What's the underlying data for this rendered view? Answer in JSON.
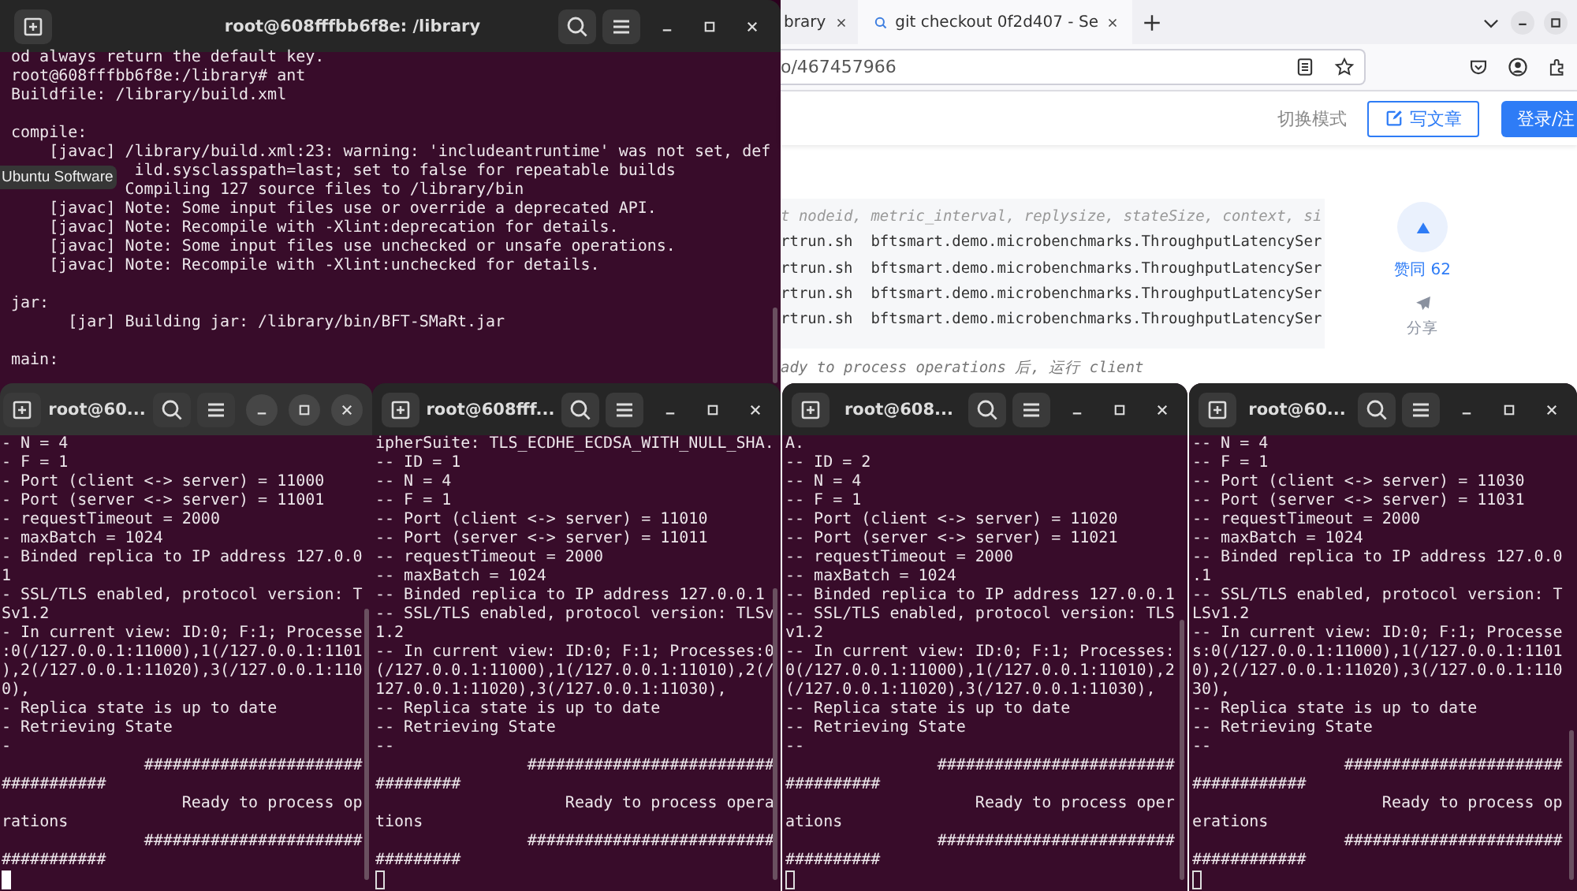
{
  "tooltip": "Ubuntu Software",
  "browser": {
    "tabs": [
      {
        "label": "brary",
        "selected": false
      },
      {
        "label": "git checkout 0f2d407 - Se",
        "selected": true
      }
    ],
    "url": "o/467457966",
    "header": {
      "mode_link": "切换模式",
      "write_button": "写文章",
      "login_button": "登录/注"
    },
    "code_lines": [
      {
        "kind": "comment",
        "text": "t nodeid, metric_interval, replysize, stateSize, context, si"
      },
      {
        "kind": "code",
        "text": "rtrun.sh  bftsmart.demo.microbenchmarks.ThroughputLatencySer"
      },
      {
        "kind": "code",
        "text": "rtrun.sh  bftsmart.demo.microbenchmarks.ThroughputLatencySer"
      },
      {
        "kind": "code",
        "text": "rtrun.sh  bftsmart.demo.microbenchmarks.ThroughputLatencySer"
      },
      {
        "kind": "code",
        "text": "rtrun.sh  bftsmart.demo.microbenchmarks.ThroughputLatencySer"
      }
    ],
    "after_code": "ady to process operations 后, 运行 client",
    "like_label": "赞同 62",
    "share_label": "分享"
  },
  "terminals": [
    {
      "title": "root@608fffbb6f8e: /library",
      "active": false,
      "blocks": [
        [
          "od always return the default key.",
          "root@608fffbb6f8e:/library# ant",
          "Buildfile: /library/build.xml"
        ],
        [
          "compile:",
          "    [javac] /library/build.xml:23: warning: 'includeantruntime' was not set, def",
          "             ild.sysclasspath=last; set to false for repeatable builds",
          "            Compiling 127 source files to /library/bin",
          "    [javac] Note: Some input files use or override a deprecated API.",
          "    [javac] Note: Recompile with -Xlint:deprecation for details.",
          "    [javac] Note: Some input files use unchecked or unsafe operations.",
          "    [javac] Note: Recompile with -Xlint:unchecked for details."
        ],
        [
          "jar:",
          "      [jar] Building jar: /library/bin/BFT-SMaRt.jar"
        ],
        [
          "main:"
        ]
      ]
    },
    {
      "title": "root@60...",
      "active": true,
      "cursor": true,
      "blocks": [
        [
          "- N = 4",
          "- F = 1",
          "- Port (client <-> server) = 11000",
          "- Port (server <-> server) = 11001",
          "- requestTimeout = 2000",
          "- maxBatch = 1024",
          "- Binded replica to IP address 127.0.0",
          "1",
          "- SSL/TLS enabled, protocol version: T",
          "Sv1.2",
          "- In current view: ID:0; F:1; Processe",
          ":0(/127.0.0.1:11000),1(/127.0.0.1:1101",
          "),2(/127.0.0.1:11020),3(/127.0.0.1:110",
          "0),",
          "- Replica state is up to date",
          "- Retrieving State",
          "-",
          "               #######################",
          "###########",
          "                   Ready to process op",
          "rations",
          "               #######################",
          "###########"
        ]
      ]
    },
    {
      "title": "root@608fff...",
      "active": false,
      "cursor": true,
      "blocks": [
        [
          "ipherSuite: TLS_ECDHE_ECDSA_WITH_NULL_SHA.",
          "-- ID = 1",
          "-- N = 4",
          "-- F = 1",
          "-- Port (client <-> server) = 11010",
          "-- Port (server <-> server) = 11011",
          "-- requestTimeout = 2000",
          "-- maxBatch = 1024",
          "-- Binded replica to IP address 127.0.0.1",
          "-- SSL/TLS enabled, protocol version: TLSv",
          "1.2",
          "-- In current view: ID:0; F:1; Processes:0",
          "(/127.0.0.1:11000),1(/127.0.0.1:11010),2(/",
          "127.0.0.1:11020),3(/127.0.0.1:11030),",
          "-- Replica state is up to date",
          "-- Retrieving State",
          "--",
          "                ##########################",
          "#########",
          "                    Ready to process opera",
          "tions",
          "                ##########################",
          "#########"
        ]
      ]
    },
    {
      "title": "root@608...",
      "active": false,
      "cursor": true,
      "blocks": [
        [
          "A.",
          "-- ID = 2",
          "-- N = 4",
          "-- F = 1",
          "-- Port (client <-> server) = 11020",
          "-- Port (server <-> server) = 11021",
          "-- requestTimeout = 2000",
          "-- maxBatch = 1024",
          "-- Binded replica to IP address 127.0.0.1",
          "-- SSL/TLS enabled, protocol version: TLS",
          "v1.2",
          "-- In current view: ID:0; F:1; Processes:",
          "0(/127.0.0.1:11000),1(/127.0.0.1:11010),2",
          "(/127.0.0.1:11020),3(/127.0.0.1:11030),",
          "-- Replica state is up to date",
          "-- Retrieving State",
          "--",
          "                #########################",
          "##########",
          "                    Ready to process oper",
          "ations",
          "                #########################",
          "##########"
        ]
      ]
    },
    {
      "title": "root@60...",
      "active": false,
      "cursor": true,
      "blocks": [
        [
          "-- N = 4",
          "-- F = 1",
          "-- Port (client <-> server) = 11030",
          "-- Port (server <-> server) = 11031",
          "-- requestTimeout = 2000",
          "-- maxBatch = 1024",
          "-- Binded replica to IP address 127.0.0",
          ".1",
          "-- SSL/TLS enabled, protocol version: T",
          "LSv1.2",
          "-- In current view: ID:0; F:1; Processe",
          "s:0(/127.0.0.1:11000),1(/127.0.0.1:1101",
          "0),2(/127.0.0.1:11020),3(/127.0.0.1:110",
          "30),",
          "-- Replica state is up to date",
          "-- Retrieving State",
          "--",
          "                #######################",
          "############",
          "                    Ready to process op",
          "erations",
          "                #######################",
          "############"
        ]
      ]
    }
  ]
}
